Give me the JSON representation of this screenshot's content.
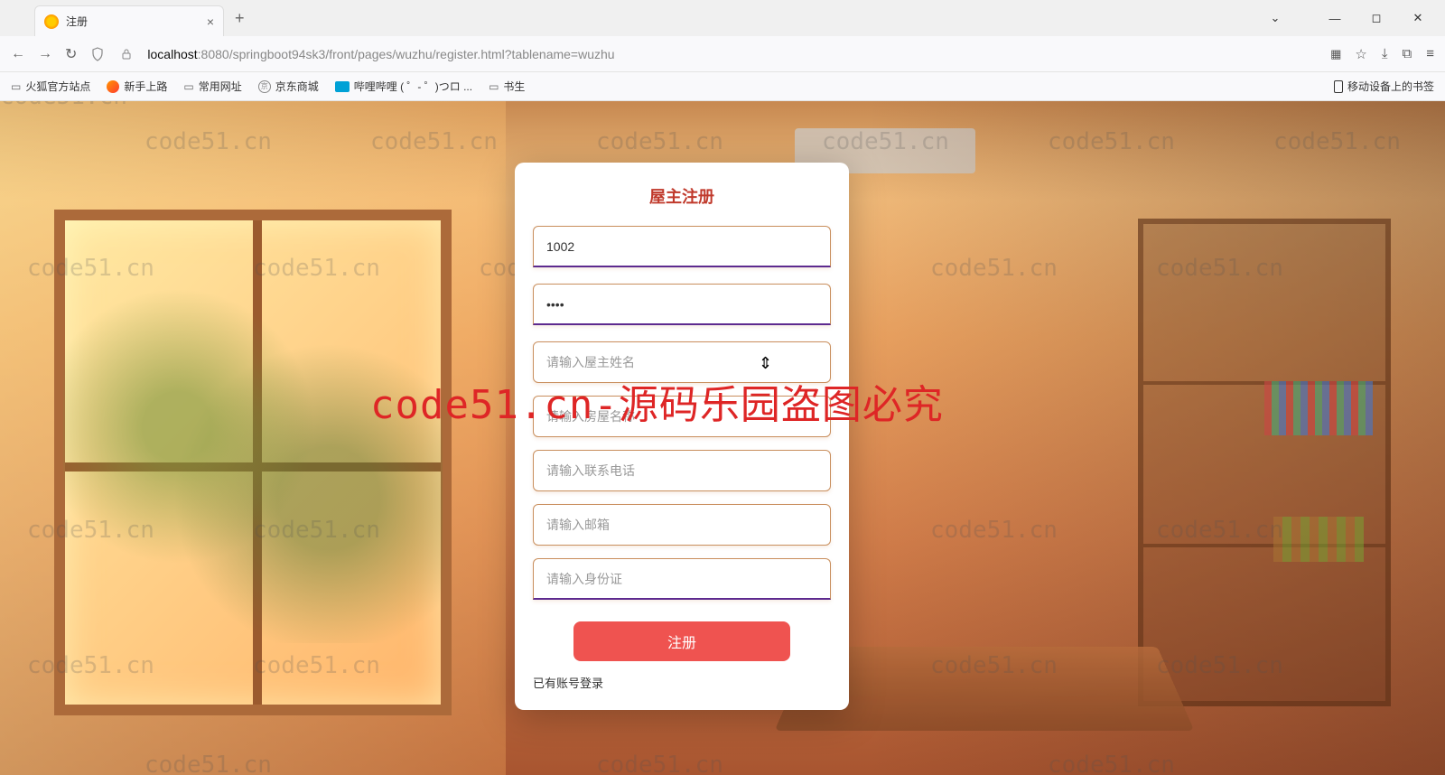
{
  "browser": {
    "tab_title": "注册",
    "url_host": "localhost",
    "url_port_path": ":8080/springboot94sk3/front/pages/wuzhu/register.html?tablename=wuzhu"
  },
  "bookmarks": {
    "b1": "火狐官方站点",
    "b2": "新手上路",
    "b3": "常用网址",
    "b4": "京东商城",
    "b5": "哔哩哔哩 (  ゜- ゜)つロ ...",
    "b6": "书生",
    "right": "移动设备上的书签"
  },
  "form": {
    "title": "屋主注册",
    "account_value": "1002",
    "password_value": "••••",
    "name_ph": "请输入屋主姓名",
    "house_ph": "请输入房屋名称",
    "phone_ph": "请输入联系电话",
    "email_ph": "请输入邮箱",
    "idcard_ph": "请输入身份证",
    "submit": "注册",
    "login_link": "已有账号登录"
  },
  "watermark": {
    "text": "code51.cn",
    "banner": "code51.cn-源码乐园盗图必究"
  }
}
